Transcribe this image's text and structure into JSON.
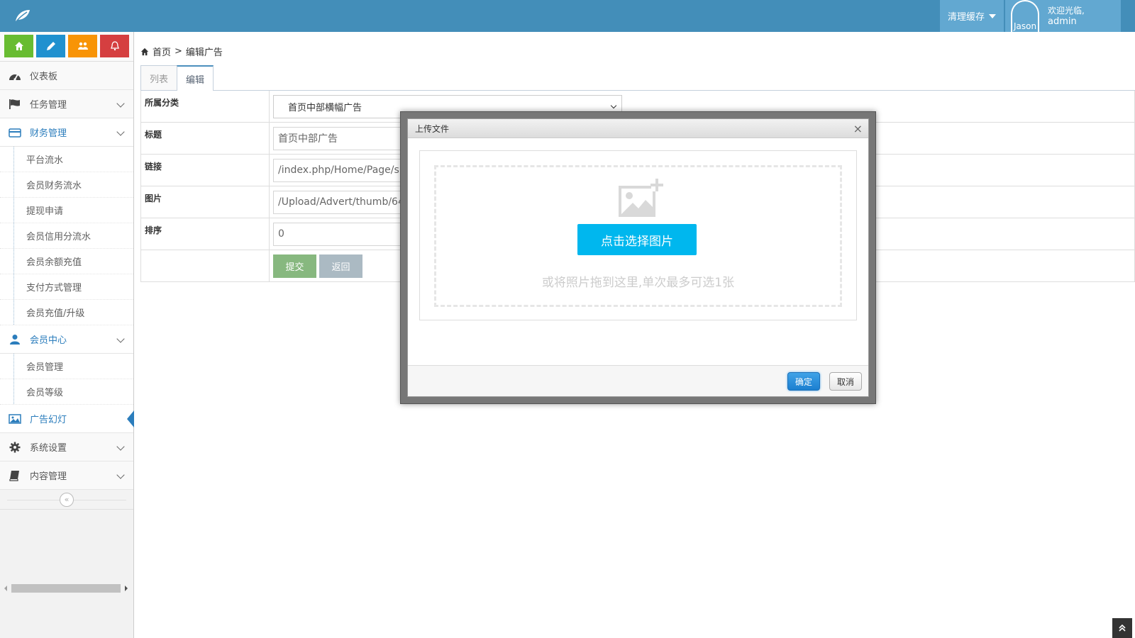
{
  "navbar": {
    "brand_icon": "leaf-icon",
    "clear_cache_label": "清理缓存",
    "avatar_text": "Jason",
    "welcome_text": "欢迎光临,",
    "username": "admin",
    "bg_color": "#438eb9"
  },
  "sidebar": {
    "shortcuts": [
      {
        "icon": "home-icon",
        "color": "#68bc31"
      },
      {
        "icon": "pencil-icon",
        "color": "#2091cf"
      },
      {
        "icon": "users-icon",
        "color": "#f89406"
      },
      {
        "icon": "bell-icon",
        "color": "#d53f40"
      }
    ],
    "dashboard": "仪表板",
    "task_mgmt": "任务管理",
    "finance_mgmt": "财务管理",
    "finance_sub": [
      "平台流水",
      "会员财务流水",
      "提现申请",
      "会员信用分流水",
      "会员余额充值",
      "支付方式管理",
      "会员充值/升级"
    ],
    "member_center": "会员中心",
    "member_sub": [
      "会员管理",
      "会员等级"
    ],
    "ads": "广告幻灯",
    "system_settings": "系统设置",
    "content_mgmt": "内容管理"
  },
  "main": {
    "breadcrumb_home": "首页",
    "breadcrumb_sep": ">",
    "breadcrumb_current": "编辑广告",
    "tabs": [
      "列表",
      "编辑"
    ],
    "form": {
      "category_label": "所属分类",
      "category_value": "首页中部横幅广告",
      "title_label": "标题",
      "title_value": "首页中部广告",
      "link_label": "链接",
      "link_value": "/index.php/Home/Page/sh",
      "image_label": "图片",
      "image_value": "/Upload/Advert/thumb/64",
      "sort_label": "排序",
      "sort_value": "0",
      "submit_label": "提交",
      "back_label": "返回"
    }
  },
  "dialog": {
    "title": "上传文件",
    "close_symbol": "×",
    "pick_button": "点击选择图片",
    "drop_hint": "或将照片拖到这里,单次最多可选1张",
    "ok_label": "确定",
    "cancel_label": "取消"
  }
}
